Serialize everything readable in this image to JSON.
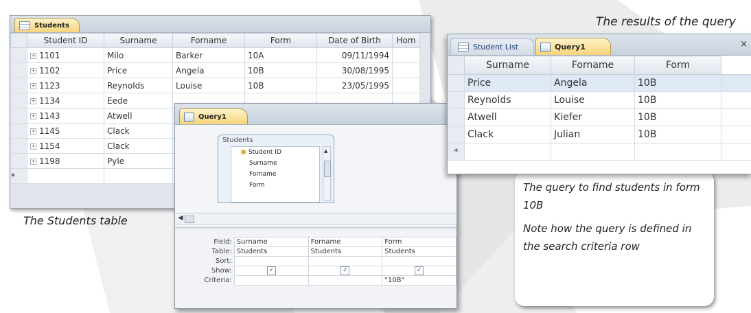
{
  "captions": {
    "results_title": "The results of the query",
    "students_table": "The Students table"
  },
  "students_window": {
    "tab_label": "Students",
    "columns": [
      "Student ID",
      "Surname",
      "Forname",
      "Form",
      "Date of Birth",
      "Hom"
    ],
    "rows": [
      {
        "id": "1101",
        "surname": "Milo",
        "forname": "Barker",
        "form": "10A",
        "dob": "09/11/1994"
      },
      {
        "id": "1102",
        "surname": "Price",
        "forname": "Angela",
        "form": "10B",
        "dob": "30/08/1995"
      },
      {
        "id": "1123",
        "surname": "Reynolds",
        "forname": "Louise",
        "form": "10B",
        "dob": "23/05/1995"
      },
      {
        "id": "1134",
        "surname": "Eede",
        "forname": "",
        "form": "",
        "dob": ""
      },
      {
        "id": "1143",
        "surname": "Atwell",
        "forname": "",
        "form": "",
        "dob": ""
      },
      {
        "id": "1145",
        "surname": "Clack",
        "forname": "",
        "form": "",
        "dob": ""
      },
      {
        "id": "1154",
        "surname": "Clack",
        "forname": "",
        "form": "",
        "dob": ""
      },
      {
        "id": "1198",
        "surname": "Pyle",
        "forname": "",
        "form": "",
        "dob": ""
      }
    ],
    "new_row_marker": "*"
  },
  "design_window": {
    "tab_label": "Query1",
    "field_list": {
      "title": "Students",
      "fields": [
        "Student ID",
        "Surname",
        "Forname",
        "Form"
      ]
    },
    "grid": {
      "row_labels": [
        "Field:",
        "Table:",
        "Sort:",
        "Show:",
        "Criteria:"
      ],
      "columns": [
        {
          "field": "Surname",
          "table": "Students",
          "sort": "",
          "show": "✓",
          "criteria": ""
        },
        {
          "field": "Forname",
          "table": "Students",
          "sort": "",
          "show": "✓",
          "criteria": ""
        },
        {
          "field": "Form",
          "table": "Students",
          "sort": "",
          "show": "✓",
          "criteria": "\"10B\""
        }
      ]
    }
  },
  "results_window": {
    "tabs": [
      "Student List",
      "Query1"
    ],
    "close_glyph": "×",
    "columns": [
      "Surname",
      "Forname",
      "Form"
    ],
    "rows": [
      {
        "surname": "Price",
        "forname": "Angela",
        "form": "10B"
      },
      {
        "surname": "Reynolds",
        "forname": "Louise",
        "form": "10B"
      },
      {
        "surname": "Atwell",
        "forname": "Kiefer",
        "form": "10B"
      },
      {
        "surname": "Clack",
        "forname": "Julian",
        "form": "10B"
      }
    ],
    "new_row_marker": "*"
  },
  "note": {
    "line1": "The query to find students in form 10B",
    "line2": "Note how the query is defined in the search criteria row"
  },
  "colors": {
    "tab_gold": "#f6d47a",
    "chrome_blue": "#c8d1dd",
    "watermark": "#e9e9e9"
  }
}
